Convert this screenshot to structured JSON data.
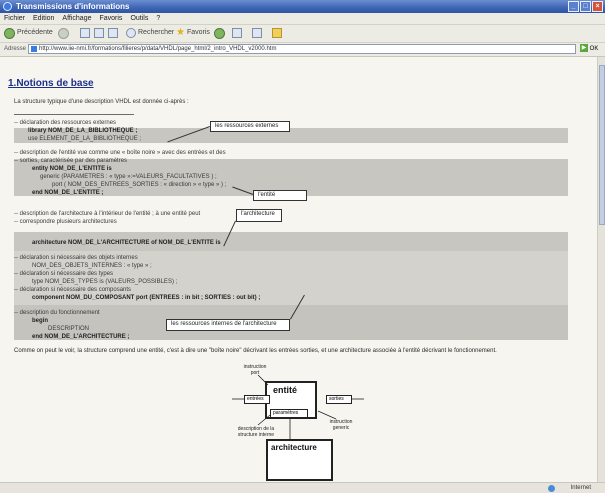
{
  "window": {
    "title": "Transmissions d'informations",
    "controls": [
      "_",
      "□",
      "×"
    ]
  },
  "menu": [
    "Fichier",
    "Edition",
    "Affichage",
    "Favoris",
    "Outils",
    "?"
  ],
  "toolbar": {
    "back_label": "Précédente",
    "search_label": "Rechercher",
    "favorites_label": "Favoris"
  },
  "address": {
    "label": "Adresse",
    "url": "http://www.iie-nmi.fr/formations/filieres/p/data/VHDL/page_html/2_intro_VHDL_v2000.htm",
    "go_label": "OK"
  },
  "page": {
    "heading": "1.Notions de base",
    "intro": "La structure typique d'une description VHDL est donnée ci-après :",
    "lines": [
      "-- déclaration des ressources externes",
      "library NOM_DE_LA_BIBLIOTHEQUE ;",
      "use ELEMENT_DE_LA_BIBLIOTHEQUE ;",
      "-- description de l'entité vue comme une « boîte noire » avec des entrées et des",
      "-- sorties, caractérisée par des paramètres",
      "entity NOM_DE_L'ENTITE is",
      "generic (PARAMETRES : « type »:=VALEURS_FACULTATIVES ) ;",
      "port ( NOM_DES_ENTREES_SORTIES : « direction » « type » ) ;",
      "end NOM_DE_L'ENTITE ;",
      "-- description de l'architecture à l'intérieur de l'entité ; à une entité peut",
      "-- correspondre plusieurs architectures",
      "architecture NOM_DE_L'ARCHITECTURE of NOM_DE_L'ENTITE is",
      "-- déclaration si nécessaire des objets internes",
      "NOM_DES_OBJETS_INTERNES : « type » ;",
      "-- déclaration si nécessaire des types",
      "type NOM_DES_TYPES is (VALEURS_POSSIBLES) ;",
      "-- déclaration si nécessaire des composants",
      "component NOM_DU_COMPOSANT port (ENTREES : in bit ;   SORTIES : out bit) ;",
      "-- description du fonctionnement",
      "begin",
      "DESCRIPTION",
      "end NOM_DE_L'ARCHITECTURE ;"
    ],
    "callouts": {
      "external": "les ressources externes",
      "entity": "l'entité",
      "architecture": "l'architecture",
      "internal": "les ressources internes de l'architecture"
    },
    "summary": "Comme on peut le voir, la structure comprend une entité, c'est à dire une \"boîte noire\" décrivant les entrées sorties, et une architecture associée à l'entité décrivant le fonctionnement."
  },
  "diagram": {
    "entity_title": "entité",
    "instruction_port": "instruction port",
    "entries": "entrées",
    "outputs": "sorties",
    "parameters": "paramètres",
    "instruction_generic": "instruction generic",
    "description_label": "description de la structure interne",
    "architecture_title": "architecture"
  },
  "status": {
    "left": "",
    "zone": "Internet"
  }
}
